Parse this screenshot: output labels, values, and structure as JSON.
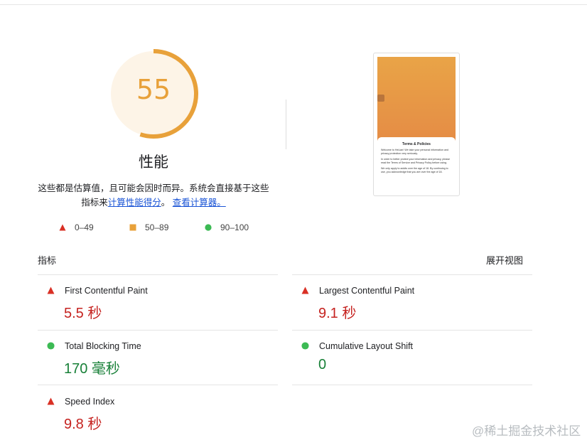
{
  "gauge": {
    "score": "55",
    "score_value": 55,
    "title": "性能"
  },
  "description": {
    "text": "这些都是估算值，且可能会因时而异。系统会直接基于这些指标来",
    "link1": "计算性能得分",
    "sep": "。",
    "link2": "查看计算器。"
  },
  "legend": [
    {
      "label": "0–49",
      "icon": "red-triangle-icon"
    },
    {
      "label": "50–89",
      "icon": "orange-square-icon"
    },
    {
      "label": "90–100",
      "icon": "green-circle-icon"
    }
  ],
  "screenshot": {
    "title": "Terms & Policies",
    "p1": "Welcome to HeLian! We take your personal information and privacy protection very seriously.",
    "p2": "In order to better protect your information and privacy, please read the Terms of Service and Privacy Policy before using.",
    "p3": "We only apply to adults over the age of 18. By continuing to use, you acknowledge that you are over the age of 18."
  },
  "metrics_header": {
    "title": "指标",
    "expand": "展开视图"
  },
  "metrics": [
    {
      "name": "First Contentful Paint",
      "value": "5.5 秒",
      "status": "fail"
    },
    {
      "name": "Largest Contentful Paint",
      "value": "9.1 秒",
      "status": "fail"
    },
    {
      "name": "Total Blocking Time",
      "value": "170 毫秒",
      "status": "pass"
    },
    {
      "name": "Cumulative Layout Shift",
      "value": "0",
      "status": "pass"
    },
    {
      "name": "Speed Index",
      "value": "9.8 秒",
      "status": "fail"
    }
  ],
  "colors": {
    "fail": "#c5221f",
    "average": "#e8a13a",
    "pass": "#188038",
    "link": "#1a54d6"
  },
  "watermark": "@稀土掘金技术社区"
}
